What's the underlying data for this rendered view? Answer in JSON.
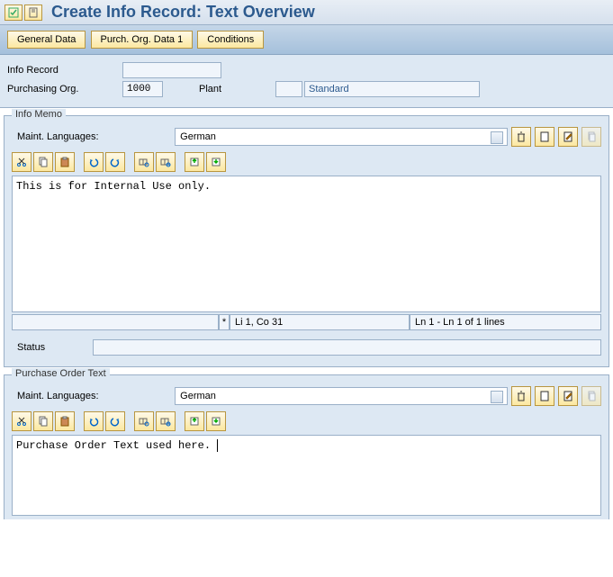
{
  "header": {
    "title": "Create Info Record: Text Overview"
  },
  "tabs": {
    "general": "General Data",
    "purch": "Purch. Org. Data 1",
    "cond": "Conditions"
  },
  "form": {
    "info_record_label": "Info Record",
    "info_record_value": "",
    "purch_org_label": "Purchasing Org.",
    "purch_org_value": "1000",
    "plant_label": "Plant",
    "plant_value": "",
    "standard": "Standard"
  },
  "memo": {
    "title": "Info Memo",
    "lang_label": "Maint. Languages:",
    "lang_value": "German",
    "text": "This is for Internal Use only.",
    "mod": "*",
    "pos": "Li 1, Co 31",
    "lines": "Ln 1 - Ln 1 of 1 lines",
    "status_label": "Status",
    "status_value": ""
  },
  "potext": {
    "title": "Purchase Order Text",
    "lang_label": "Maint. Languages:",
    "lang_value": "German",
    "text": "Purchase Order Text used here."
  },
  "icons": {
    "trash": "🗑",
    "page": "▭",
    "edit": "✎",
    "copy": "⎘",
    "cut": "✂",
    "paste": "📋",
    "undo": "↶",
    "redo": "↷",
    "save": "💾",
    "find": "🔍",
    "back": "⇦",
    "fwd": "⇨"
  }
}
